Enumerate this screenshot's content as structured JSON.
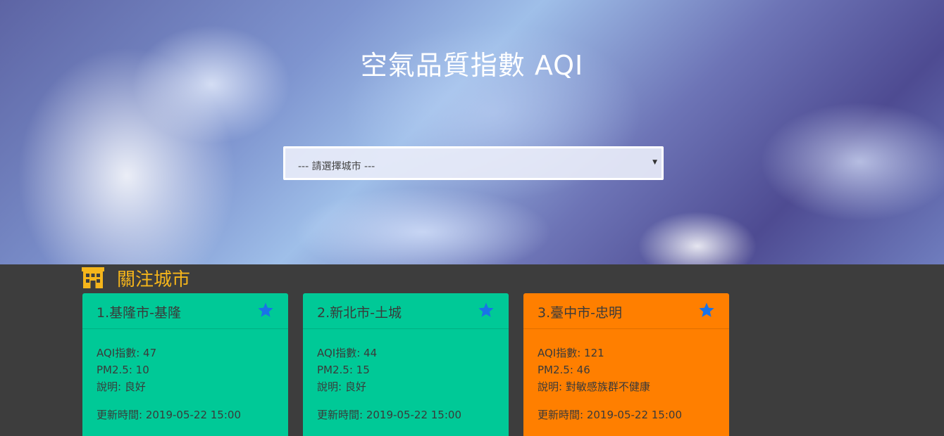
{
  "hero": {
    "title": "空氣品質指數 AQI",
    "select_value": "--- 請選擇城市 ---"
  },
  "section": {
    "title": "關注城市",
    "icon": "building-icon"
  },
  "cards": [
    {
      "title": "1.基隆市-基隆",
      "aqi": "AQI指數: 47",
      "pm25": "PM2.5: 10",
      "desc": "說明: 良好",
      "updated": "更新時間: 2019-05-22 15:00",
      "color": "#00c997"
    },
    {
      "title": "2.新北市-土城",
      "aqi": "AQI指數: 44",
      "pm25": "PM2.5: 15",
      "desc": "說明: 良好",
      "updated": "更新時間: 2019-05-22 15:00",
      "color": "#00c997"
    },
    {
      "title": "3.臺中市-忠明",
      "aqi": "AQI指數: 121",
      "pm25": "PM2.5: 46",
      "desc": "說明: 對敏感族群不健康",
      "updated": "更新時間: 2019-05-22 15:00",
      "color": "#ff7f00"
    }
  ],
  "colors": {
    "accent": "#f5b51b",
    "star": "#1a73e8",
    "background": "#3d3d3d"
  }
}
